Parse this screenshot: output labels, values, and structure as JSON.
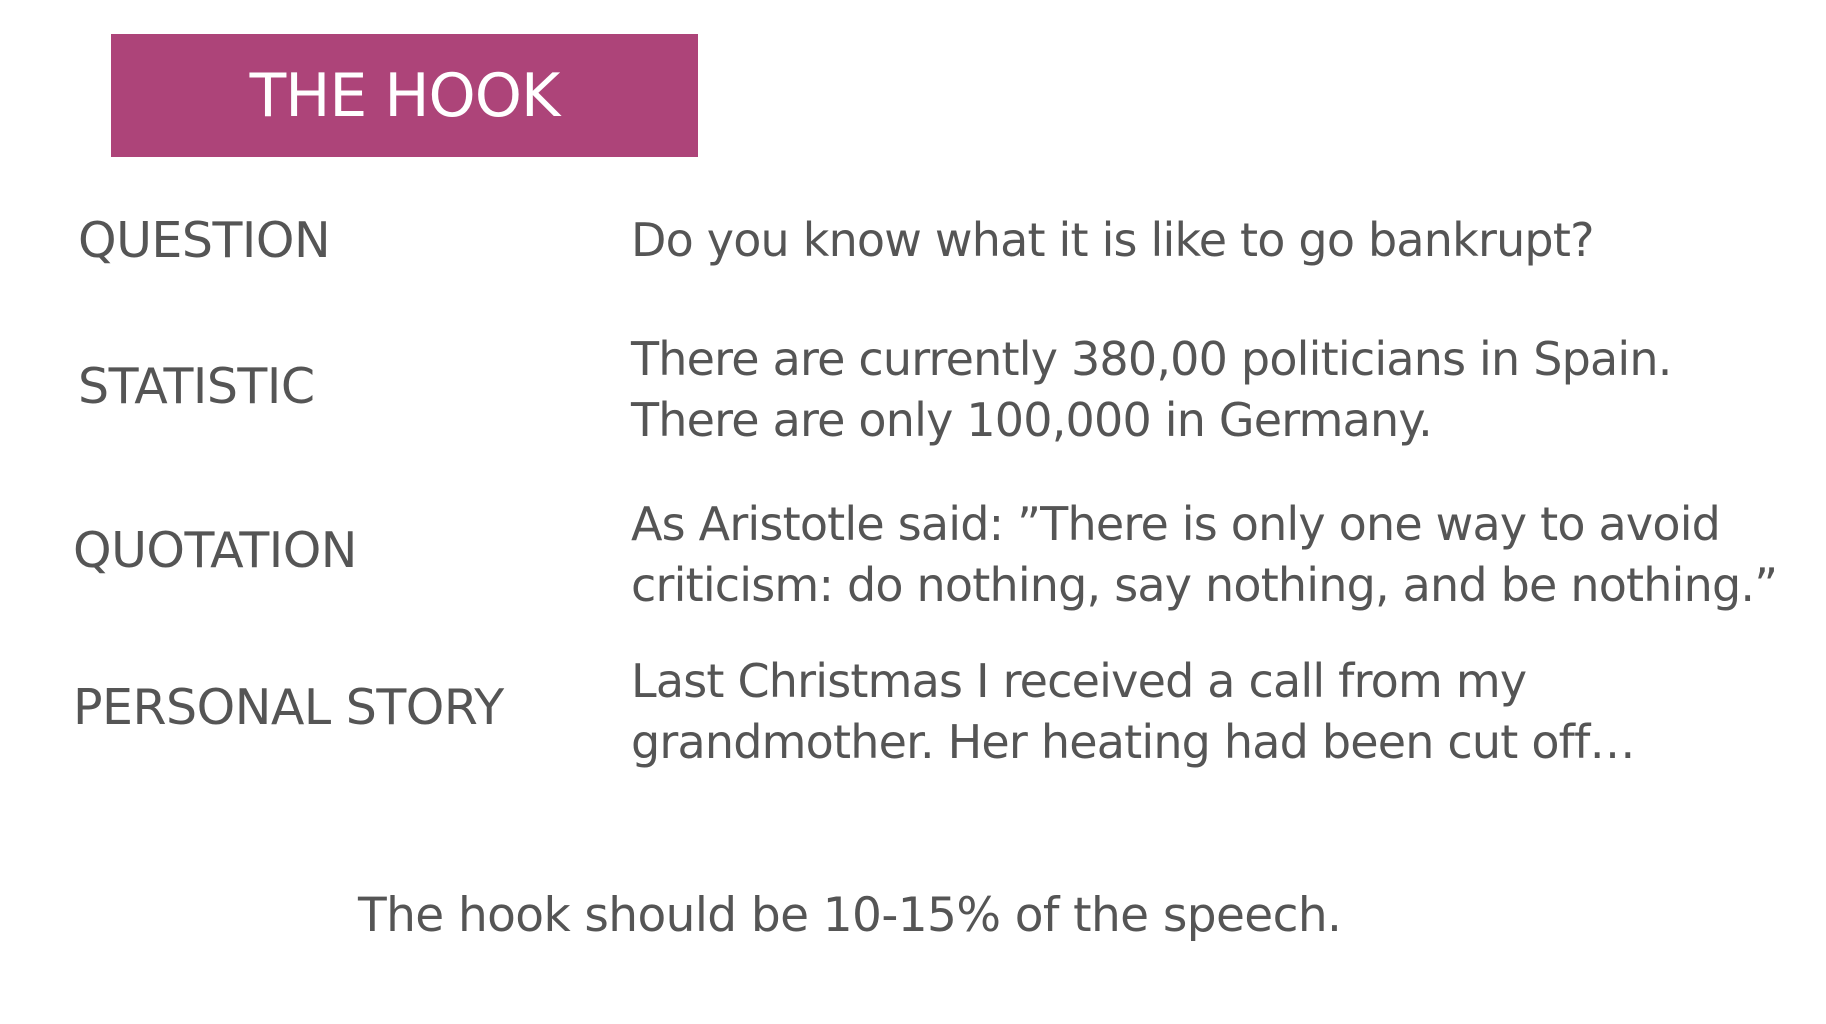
{
  "title": "THE HOOK",
  "rows": [
    {
      "label": "QUESTION",
      "lines": [
        "Do you know what it is like to go bankrupt?"
      ]
    },
    {
      "label": "STATISTIC",
      "lines": [
        "There are currently 380,00 politicians in Spain.",
        "There are only 100,000 in Germany."
      ]
    },
    {
      "label": "QUOTATION",
      "lines": [
        "As Aristotle said: ”There is only one way to avoid",
        "criticism: do nothing, say nothing, and be nothing.”"
      ]
    },
    {
      "label": "PERSONAL STORY",
      "lines": [
        "Last Christmas I received a call from my",
        "grandmother. Her heating had been cut off…"
      ]
    }
  ],
  "footer": "The hook should be 10-15% of the speech.",
  "colors": {
    "title_background": "#ad4479",
    "title_text": "#ffffff",
    "body_text": "#555555",
    "background": "#ffffff"
  }
}
